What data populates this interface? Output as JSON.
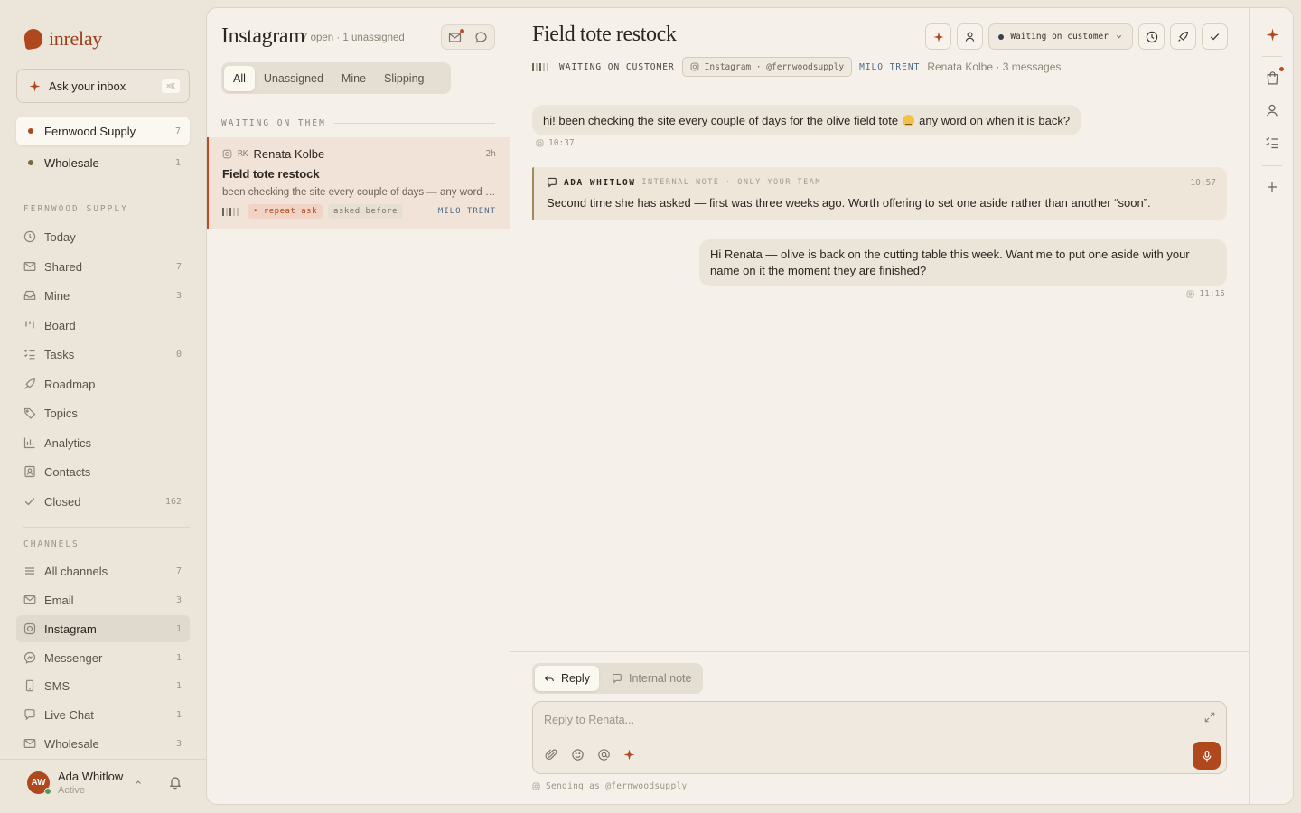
{
  "app": {
    "name": "inrelay"
  },
  "colors": {
    "accent": "#b0481e",
    "warning_chip": "#f0d3c4",
    "assignee": "#4e6a87",
    "online": "#4e9c63"
  },
  "ask": {
    "label": "Ask your inbox",
    "shortcut": "⌘K"
  },
  "workspaces": [
    {
      "label": "Fernwood Supply",
      "count": "7",
      "dot": "#b0481e",
      "active": true
    },
    {
      "label": "Wholesale",
      "count": "1",
      "dot": "#7a6a3a",
      "active": false
    }
  ],
  "sidebar": {
    "section_label": "FERNWOOD SUPPLY",
    "items": [
      {
        "label": "Today",
        "count": "",
        "icon": "clock-icon"
      },
      {
        "label": "Shared",
        "count": "7",
        "icon": "mail-icon"
      },
      {
        "label": "Mine",
        "count": "3",
        "icon": "inbox-icon"
      },
      {
        "label": "Board",
        "count": "",
        "icon": "board-icon"
      },
      {
        "label": "Tasks",
        "count": "0",
        "icon": "tasks-icon"
      },
      {
        "label": "Roadmap",
        "count": "",
        "icon": "rocket-icon"
      },
      {
        "label": "Topics",
        "count": "",
        "icon": "tag-icon"
      },
      {
        "label": "Analytics",
        "count": "",
        "icon": "chart-icon"
      },
      {
        "label": "Contacts",
        "count": "",
        "icon": "contact-icon"
      },
      {
        "label": "Closed",
        "count": "162",
        "icon": "check-icon"
      }
    ],
    "channels_label": "CHANNELS",
    "channels": [
      {
        "label": "All channels",
        "count": "7",
        "icon": "list-icon",
        "active": false
      },
      {
        "label": "Email",
        "count": "3",
        "icon": "mail-icon",
        "active": false
      },
      {
        "label": "Instagram",
        "count": "1",
        "icon": "instagram-icon",
        "active": true
      },
      {
        "label": "Messenger",
        "count": "1",
        "icon": "messenger-icon",
        "active": false
      },
      {
        "label": "SMS",
        "count": "1",
        "icon": "phone-icon",
        "active": false
      },
      {
        "label": "Live Chat",
        "count": "1",
        "icon": "chat-icon",
        "active": false
      },
      {
        "label": "Wholesale",
        "count": "3",
        "icon": "mail-icon",
        "active": false
      }
    ]
  },
  "user": {
    "initials": "AW",
    "name": "Ada Whitlow",
    "status": "Active"
  },
  "list": {
    "title": "Instagram",
    "subtitle": "7 open · 1 unassigned",
    "tabs": [
      "All",
      "Unassigned",
      "Mine",
      "Slipping"
    ],
    "active_tab": "All",
    "group_label": "WAITING ON THEM",
    "conversations": [
      {
        "initials": "RK",
        "name": "Renata Kolbe",
        "age": "2h",
        "subject": "Field tote restock",
        "preview": "been checking the site every couple of days — any word on...",
        "tags": [
          "• repeat ask",
          "asked before"
        ],
        "assignee": "MILO TRENT"
      }
    ]
  },
  "conversation": {
    "title": "Field tote restock",
    "status_select": "Waiting on customer",
    "state_label": "WAITING ON CUSTOMER",
    "channel_chip": "Instagram · @fernwoodsupply",
    "assignee": "MILO TRENT",
    "customer_meta": "Renata Kolbe · 3 messages",
    "messages": [
      {
        "type": "inbound",
        "text_before": "hi! been checking the site every couple of days for the olive field tote",
        "text_after": "any word on when it is back?",
        "time": "10:37"
      },
      {
        "type": "note",
        "author": "ADA WHITLOW",
        "tag": "INTERNAL NOTE · ONLY YOUR TEAM",
        "time": "10:57",
        "text": "Second time she has asked — first was three weeks ago. Worth offering to set one aside rather than another “soon”."
      },
      {
        "type": "outbound",
        "text": "Hi Renata — olive is back on the cutting table this week. Want me to put one aside with your name on it the moment they are finished?",
        "time": "11:15"
      }
    ]
  },
  "composer": {
    "modes": [
      "Reply",
      "Internal note"
    ],
    "active_mode": "Reply",
    "placeholder": "Reply to Renata...",
    "sending_as": "Sending as @fernwoodsupply"
  }
}
